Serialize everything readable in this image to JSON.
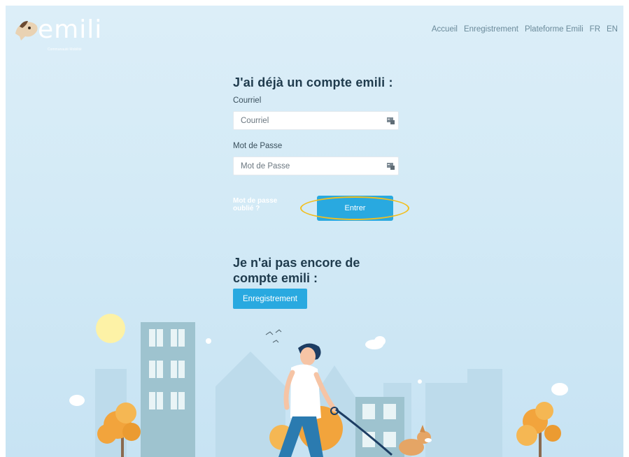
{
  "brand": {
    "logo_text": "emili",
    "tagline": "Communauté Mobilité"
  },
  "nav": {
    "items": [
      {
        "label": "Accueil"
      },
      {
        "label": "Enregistrement"
      },
      {
        "label": "Plateforme Emili"
      },
      {
        "label": "FR"
      },
      {
        "label": "EN"
      }
    ]
  },
  "login": {
    "heading": "J'ai déjà un compte emili :",
    "email_label": "Courriel",
    "email_placeholder": "Courriel",
    "password_label": "Mot de Passe",
    "password_placeholder": "Mot de Passe",
    "forgot_label": "Mot de passe oublié ?",
    "submit_label": "Entrer"
  },
  "register": {
    "heading": "Je n'ai pas encore de compte emili :",
    "button_label": "Enregistrement"
  },
  "colors": {
    "accent": "#29a9e0",
    "highlight": "#f2bf1f",
    "heading": "#1f3b4d",
    "background": "#d3eaf6"
  },
  "icons": {
    "field_icon": "id-card-icon",
    "logo_mark": "dog-logo-icon"
  }
}
